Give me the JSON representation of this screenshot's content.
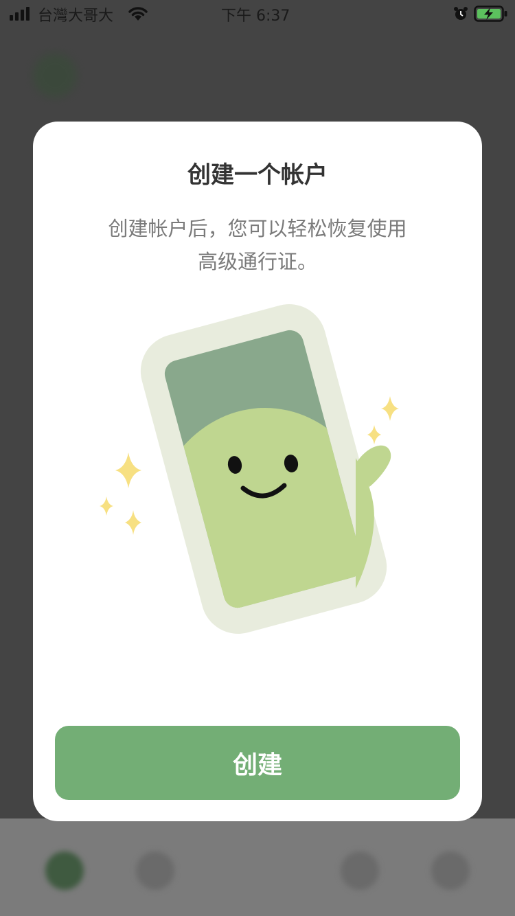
{
  "status_bar": {
    "carrier": "台灣大哥大",
    "time": "下午 6:37",
    "icons": [
      "signal-icon",
      "wifi-icon",
      "alarm-icon",
      "battery-charging-icon"
    ]
  },
  "modal": {
    "title": "创建一个帐户",
    "description_line1": "创建帐户后，您可以轻松恢复使用",
    "description_line2": "高级通行证。",
    "create_button_label": "创建"
  },
  "colors": {
    "accent": "#73ae75",
    "phone_frame": "#e8ecdd",
    "phone_screen": "#89a88c",
    "character": "#bfd690",
    "sparkle": "#f7e082"
  }
}
